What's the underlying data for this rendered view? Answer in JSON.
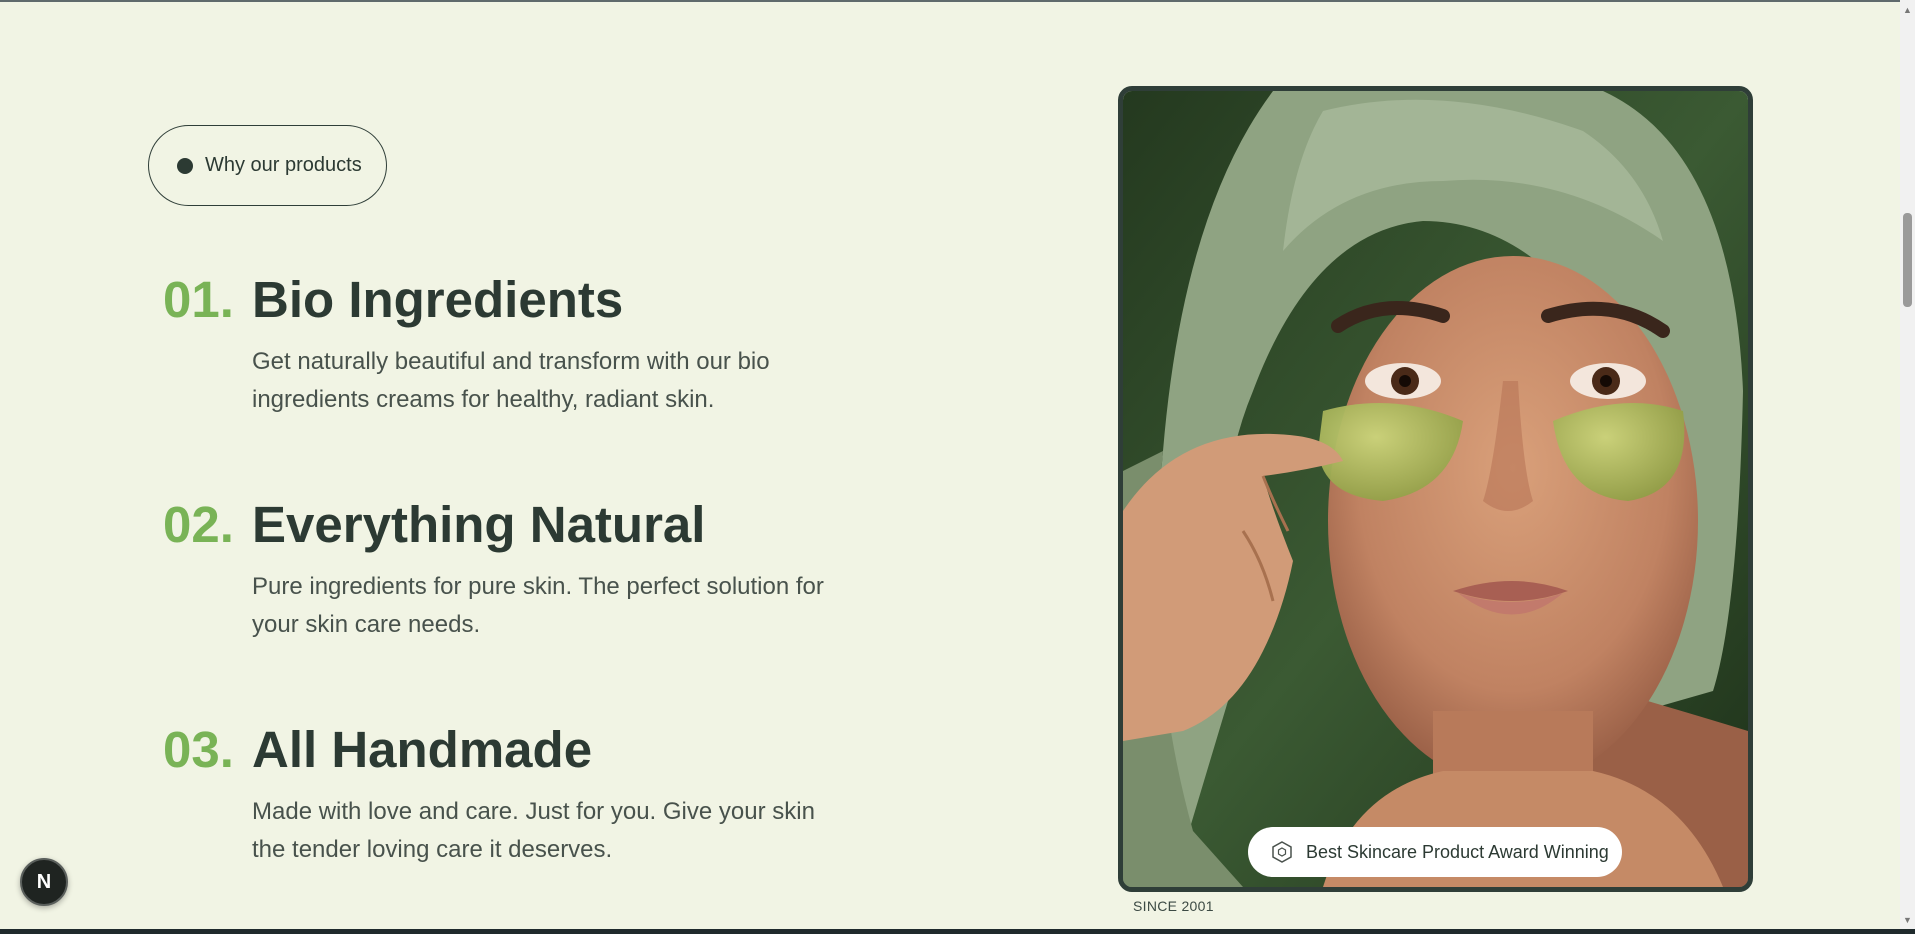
{
  "badge": {
    "label": "Why our products"
  },
  "features": [
    {
      "number": "01.",
      "title": "Bio Ingredients",
      "description": "Get naturally beautiful and transform with our bio ingredients creams for healthy, radiant skin."
    },
    {
      "number": "02.",
      "title": "Everything Natural",
      "description": "Pure ingredients for pure skin. The perfect solution for your skin care needs."
    },
    {
      "number": "03.",
      "title": "All Handmade",
      "description": "Made with love and care. Just for you. Give your skin the tender loving care it deserves."
    }
  ],
  "image": {
    "award_text": "Best Skincare Product Award Winning",
    "award_icon": "award-hexagon-icon",
    "since_text": "SINCE 2001"
  },
  "dev_badge": {
    "letter": "N",
    "icon": "nextjs-logo-icon"
  },
  "colors": {
    "background": "#f1f4e4",
    "accent_green": "#79b356",
    "text_dark": "#2c3a33",
    "frame_border": "#2f3e38"
  }
}
